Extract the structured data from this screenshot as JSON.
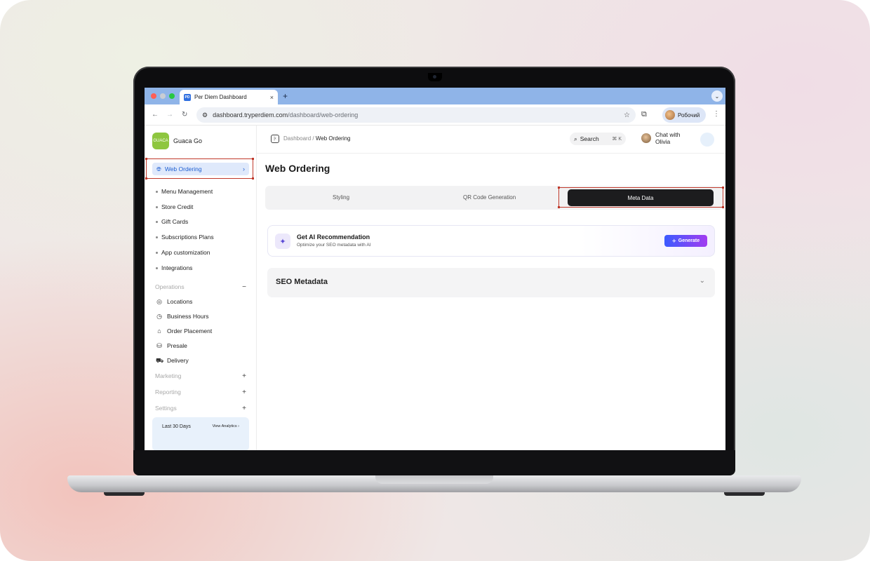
{
  "browser": {
    "tab_title": "Per Diem Dashboard",
    "tab_close": "×",
    "new_tab": "+",
    "url_domain": "dashboard.tryperdiem.com",
    "url_path": "/dashboard/web-ordering",
    "profile_name": "Робочий"
  },
  "brand": {
    "name": "Guaca Go",
    "logo_text": "GUACA"
  },
  "sidebar": {
    "active": "Web Ordering",
    "sub_items": [
      "Menu Management",
      "Store Credit",
      "Gift Cards",
      "Subscriptions Plans",
      "App customization",
      "Integrations"
    ],
    "operations_label": "Operations",
    "operations_items": [
      "Locations",
      "Business Hours",
      "Order Placement",
      "Presale",
      "Delivery"
    ],
    "marketing_label": "Marketing",
    "reporting_label": "Reporting",
    "settings_label": "Settings",
    "collapse_symbol": "−",
    "expand_symbol": "+",
    "analytics_range": "Last 30 Days",
    "analytics_link": "View Analytics"
  },
  "topbar": {
    "crumb_root": "Dashboard",
    "crumb_sep": "/",
    "crumb_current": "Web Ordering",
    "search_label": "Search",
    "search_kbd": "⌘ K",
    "chat_line1": "Chat with",
    "chat_line2": "Olivia"
  },
  "main": {
    "title": "Web Ordering",
    "tabs": [
      "Styling",
      "QR Code Generation",
      "Meta Data"
    ],
    "ai_title": "Get AI Recommendation",
    "ai_subtitle": "Optimize your SEO metadata with AI",
    "generate_label": "Generate",
    "seo_label": "SEO Metadata"
  },
  "colors": {
    "accent": "#1f5fd1",
    "highlight": "#c0392b",
    "dark_tab": "#1c1c1e"
  }
}
